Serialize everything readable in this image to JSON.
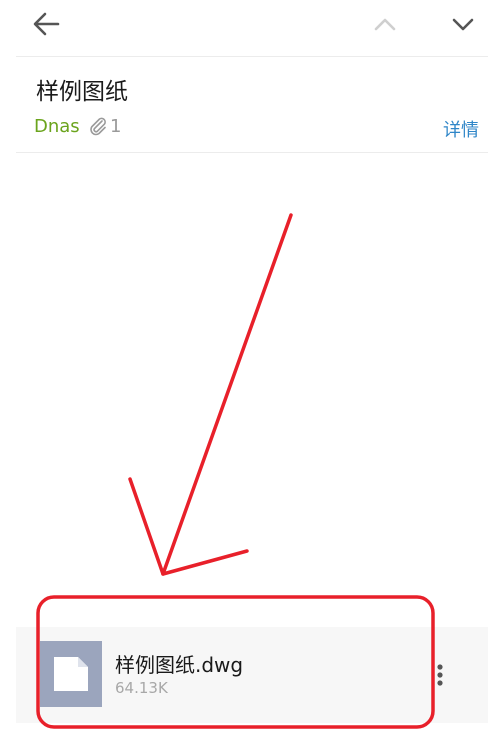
{
  "header": {
    "back_icon": "arrow-left-icon",
    "prev_icon": "chevron-up-icon",
    "next_icon": "chevron-down-icon"
  },
  "mail": {
    "subject": "样例图纸",
    "sender": "Dnas",
    "attachment_icon": "paperclip-icon",
    "attachment_count": "1",
    "details_label": "详情"
  },
  "attachment": {
    "file_icon": "document-icon",
    "name": "样例图纸.dwg",
    "size": "64.13K",
    "more_icon": "more-vertical-icon"
  },
  "annotation": {
    "color": "#e8202a"
  },
  "colors": {
    "sender": "#6ba41d",
    "details_link": "#2f86c8",
    "file_thumb": "#9ba5bd"
  }
}
